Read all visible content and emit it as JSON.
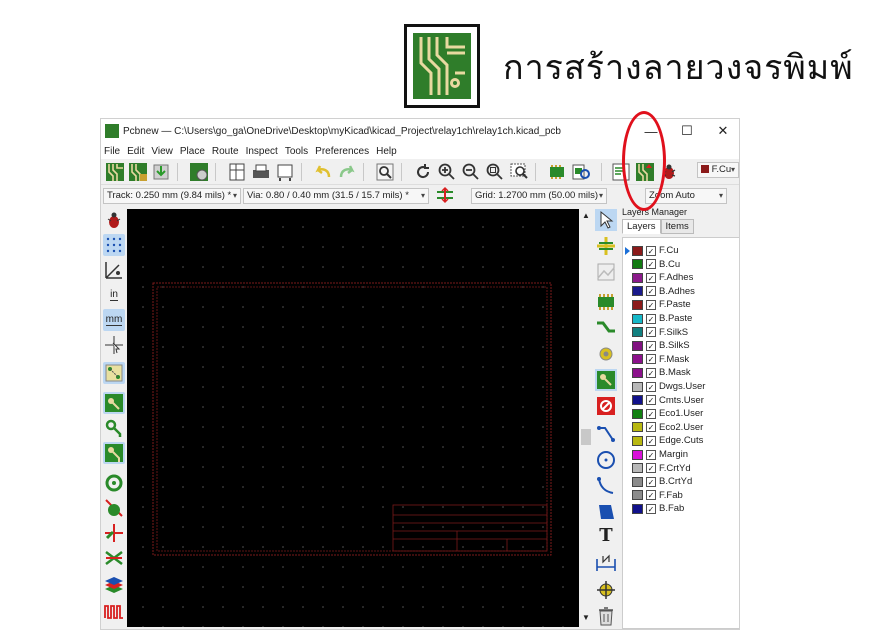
{
  "slide": {
    "title": "การสร้างลายวงจรพิมพ์"
  },
  "window": {
    "title": "Pcbnew — C:\\Users\\go_ga\\OneDrive\\Desktop\\myKicad\\kicad_Project\\relay1ch\\relay1ch.kicad_pcb",
    "minimize": "—",
    "maximize": "☐",
    "close": "✕"
  },
  "menu": [
    "File",
    "Edit",
    "View",
    "Place",
    "Route",
    "Inspect",
    "Tools",
    "Preferences",
    "Help"
  ],
  "options": {
    "track": "Track: 0.250 mm (9.84 mils) *",
    "via": "Via: 0.80 / 0.40 mm (31.5 / 15.7 mils) *",
    "grid": "Grid: 1.2700 mm (50.00 mils)",
    "zoom": "Zoom Auto",
    "layer_select": "F.Cu"
  },
  "layers_manager": {
    "title": "Layers Manager",
    "tabs": [
      "Layers",
      "Items"
    ],
    "selected": "F.Cu",
    "layers": [
      {
        "name": "F.Cu",
        "color": "#8b1a1a",
        "checked": "✓"
      },
      {
        "name": "B.Cu",
        "color": "#117a11",
        "checked": "✓"
      },
      {
        "name": "F.Adhes",
        "color": "#8b1a8b",
        "checked": "✓"
      },
      {
        "name": "B.Adhes",
        "color": "#1a1a8b",
        "checked": "✓"
      },
      {
        "name": "F.Paste",
        "color": "#8b1a1a",
        "checked": "✓"
      },
      {
        "name": "B.Paste",
        "color": "#16b8c8",
        "checked": "✓"
      },
      {
        "name": "F.SilkS",
        "color": "#118080",
        "checked": "✓"
      },
      {
        "name": "B.SilkS",
        "color": "#801180",
        "checked": "✓"
      },
      {
        "name": "F.Mask",
        "color": "#8b118b",
        "checked": "✓"
      },
      {
        "name": "B.Mask",
        "color": "#8b118b",
        "checked": "✓"
      },
      {
        "name": "Dwgs.User",
        "color": "#b8b8b8",
        "checked": "✓"
      },
      {
        "name": "Cmts.User",
        "color": "#11118b",
        "checked": "✓"
      },
      {
        "name": "Eco1.User",
        "color": "#118011",
        "checked": "✓"
      },
      {
        "name": "Eco2.User",
        "color": "#b8b811",
        "checked": "✓"
      },
      {
        "name": "Edge.Cuts",
        "color": "#b8b811",
        "checked": "✓"
      },
      {
        "name": "Margin",
        "color": "#d811d8",
        "checked": "✓"
      },
      {
        "name": "F.CrtYd",
        "color": "#b8b8b8",
        "checked": "✓"
      },
      {
        "name": "B.CrtYd",
        "color": "#8b8b8b",
        "checked": "✓"
      },
      {
        "name": "F.Fab",
        "color": "#8b8b8b",
        "checked": "✓"
      },
      {
        "name": "B.Fab",
        "color": "#11118b",
        "checked": "✓"
      }
    ]
  },
  "left_toolbar_labels": {
    "inch": "in",
    "mm": "mm"
  },
  "colors": {
    "annotation": "#e0101c",
    "pcb_bg": "#000000",
    "sheet_border": "#7a1a1a",
    "logo_green": "#2f7d2a"
  }
}
